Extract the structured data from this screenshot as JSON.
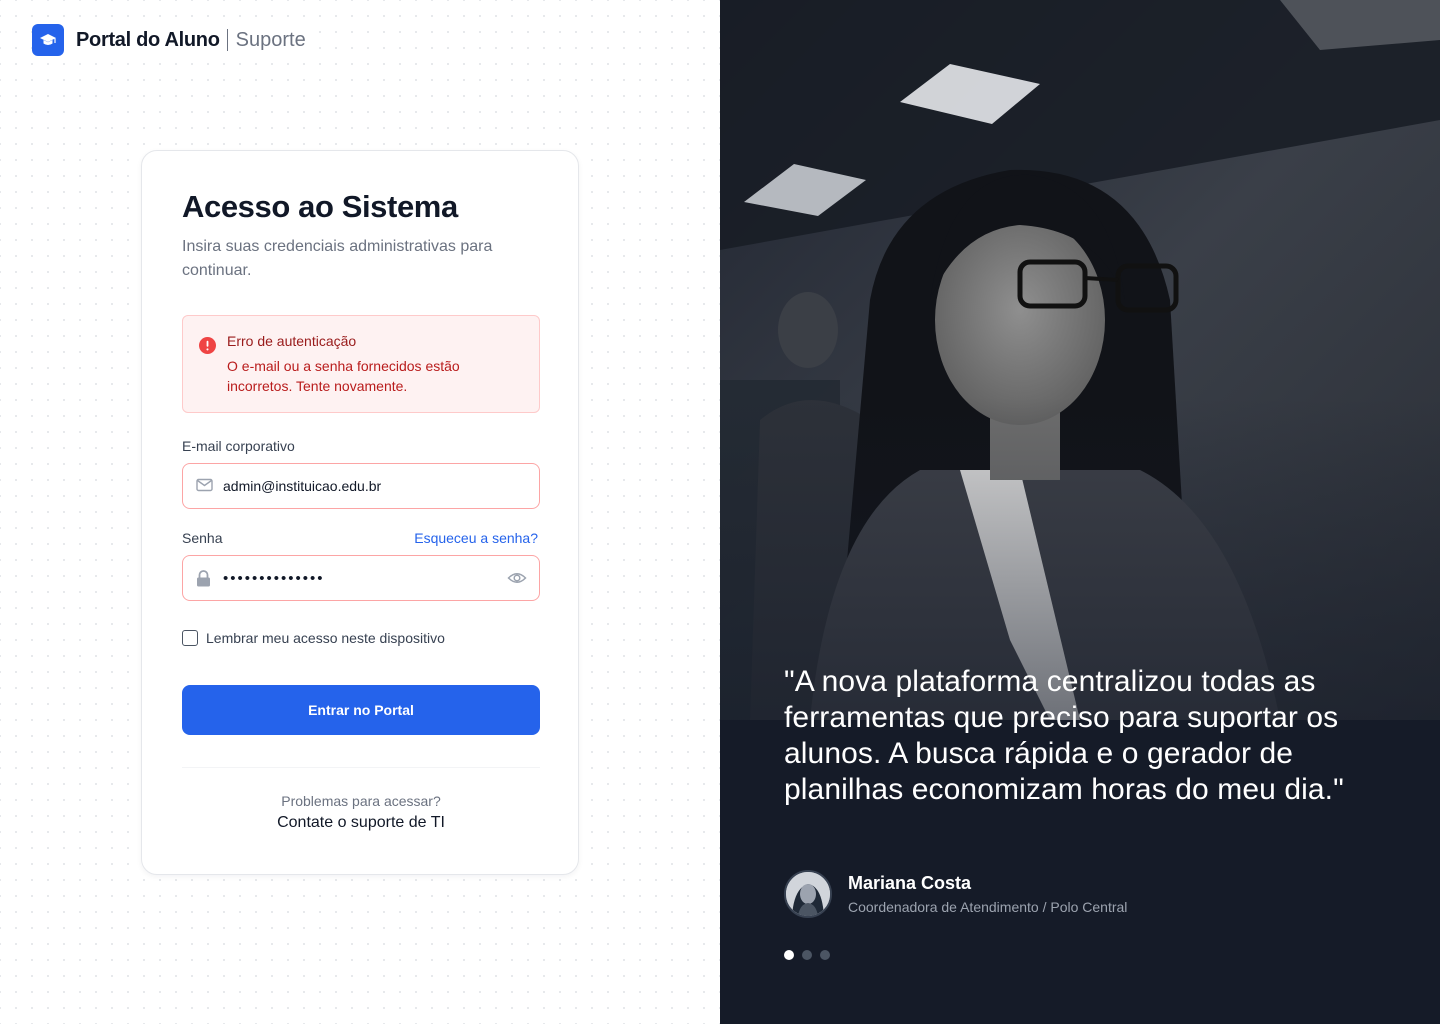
{
  "brand": {
    "name": "Portal do Aluno",
    "section": "Suporte"
  },
  "login": {
    "title": "Acesso ao Sistema",
    "subtitle": "Insira suas credenciais administrativas para continuar.",
    "alert": {
      "title": "Erro de autenticação",
      "message": "O e-mail ou a senha fornecidos estão incorretos. Tente novamente."
    },
    "email_label": "E-mail corporativo",
    "email_value": "admin@instituicao.edu.br",
    "password_label": "Senha",
    "forgot_link": "Esqueceu a senha?",
    "password_value": "••••••••••••••",
    "remember_label": "Lembrar meu acesso neste dispositivo",
    "remember_checked": false,
    "submit_label": "Entrar no Portal",
    "help_question": "Problemas para acessar?",
    "help_link": "Contate o suporte de TI"
  },
  "testimonial": {
    "quote": "\"A nova plataforma centralizou todas as ferramentas que preciso para suportar os alunos. A busca rápida e o gerador de planilhas economizam horas do meu dia.\"",
    "author_name": "Mariana Costa",
    "author_role": "Coordenadora de Atendimento / Polo Central",
    "slides_total": 3,
    "slide_active": 1
  },
  "colors": {
    "primary": "#2563eb",
    "error_bg": "#fef2f2",
    "error_border": "#fecaca",
    "error_text": "#b91c1c",
    "dark_panel": "#151b28"
  },
  "icons": {
    "brand": "graduation-cap-icon",
    "alert": "exclamation-circle-icon",
    "email": "envelope-icon",
    "password": "lock-icon",
    "toggle": "eye-icon"
  }
}
